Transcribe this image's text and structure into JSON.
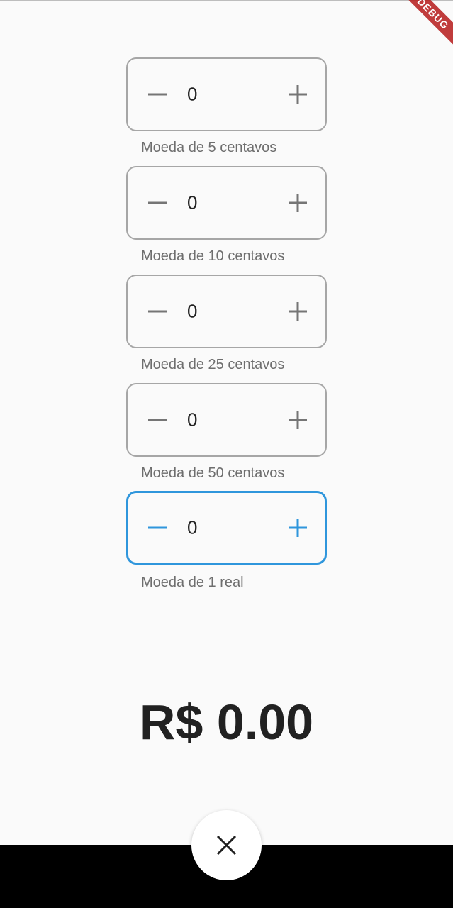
{
  "debug_banner": {
    "text": "DEBUG"
  },
  "steppers": [
    {
      "count": "0",
      "label": "Moeda de 5 centavos",
      "focused": false
    },
    {
      "count": "0",
      "label": "Moeda de 10 centavos",
      "focused": false
    },
    {
      "count": "0",
      "label": "Moeda de 25 centavos",
      "focused": false
    },
    {
      "count": "0",
      "label": "Moeda de 50 centavos",
      "focused": false
    },
    {
      "count": "0",
      "label": "Moeda de 1 real",
      "focused": true
    }
  ],
  "total": {
    "text": "R$ 0.00"
  },
  "fab": {
    "icon": "close-icon"
  },
  "colors": {
    "accent": "#2f96dc",
    "border": "#a6a6a6",
    "background": "#fafafa",
    "debug_banner": "#b71c1c"
  }
}
